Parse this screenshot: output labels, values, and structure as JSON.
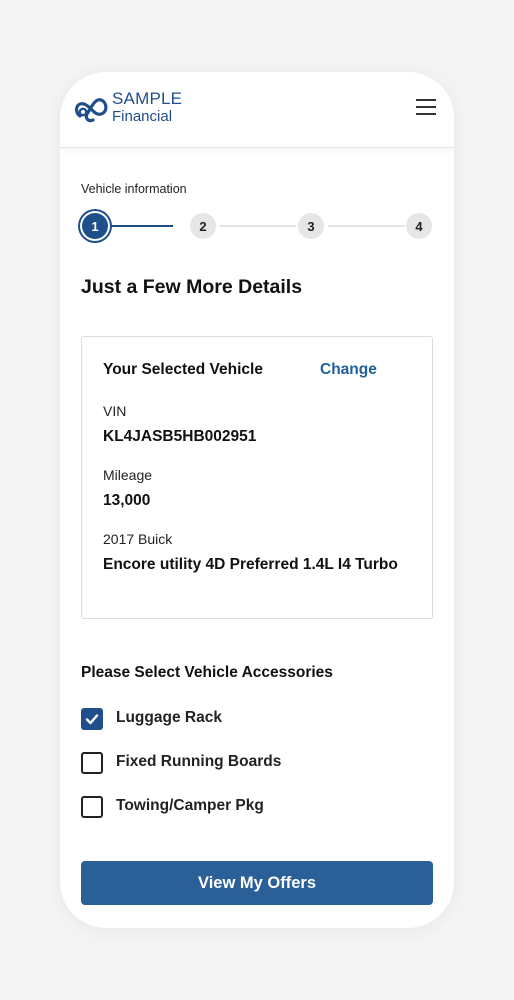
{
  "brand": {
    "line1": "SAMPLE",
    "line2": "Financial",
    "accent_color": "#1f4f8a"
  },
  "header": {
    "menu_icon": "hamburger-menu-icon"
  },
  "progress": {
    "title": "Vehicle information",
    "steps": [
      "1",
      "2",
      "3",
      "4"
    ],
    "current_step": 1
  },
  "page": {
    "heading": "Just a Few More Details"
  },
  "vehicle_card": {
    "title": "Your Selected Vehicle",
    "change_label": "Change",
    "vin_label": "VIN",
    "vin_value": "KL4JASB5HB002951",
    "mileage_label": "Mileage",
    "mileage_value": "13,000",
    "model_label": "2017 Buick",
    "model_value": "Encore utility 4D Preferred 1.4L I4 Turbo"
  },
  "accessories": {
    "heading": "Please Select Vehicle Accessories",
    "items": [
      {
        "label": "Luggage Rack",
        "checked": true
      },
      {
        "label": "Fixed Running Boards",
        "checked": false
      },
      {
        "label": "Towing/Camper Pkg",
        "checked": false
      }
    ]
  },
  "cta": {
    "label": "View My Offers"
  }
}
